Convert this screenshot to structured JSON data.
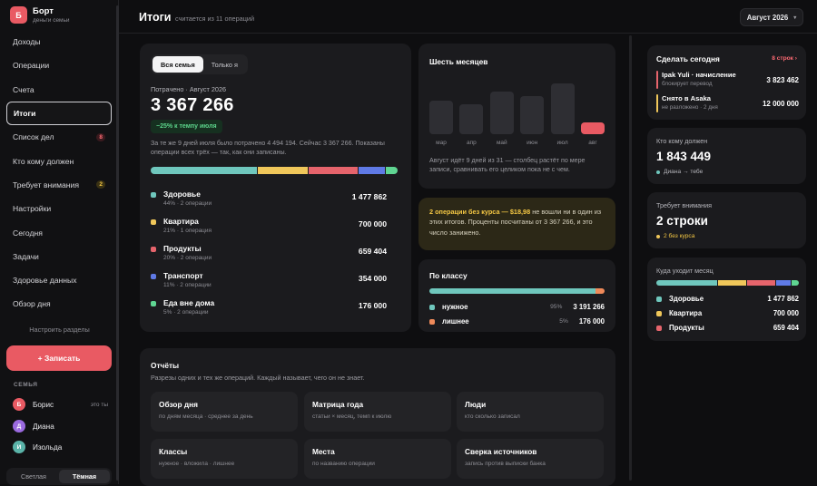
{
  "brand": {
    "logo_letter": "Б",
    "title": "Борт",
    "subtitle": "деньги семьи"
  },
  "nav": [
    {
      "label": "Доходы"
    },
    {
      "label": "Операции"
    },
    {
      "label": "Счета"
    },
    {
      "label": "Итоги",
      "active": true
    },
    {
      "label": "Список дел",
      "badge": "8",
      "badge_color": "red"
    },
    {
      "label": "Кто кому должен"
    },
    {
      "label": "Требует внимания",
      "badge": "2",
      "badge_color": "yellow"
    },
    {
      "label": "Настройки"
    },
    {
      "label": "Сегодня"
    },
    {
      "label": "Задачи"
    },
    {
      "label": "Здоровье данных"
    },
    {
      "label": "Обзор дня"
    }
  ],
  "configure_label": "Настроить разделы",
  "write_button": "+ Записать",
  "family_heading": "СЕМЬЯ",
  "members": [
    {
      "letter": "Б",
      "name": "Борис",
      "note": "это ты",
      "color": "#e95a63"
    },
    {
      "letter": "Д",
      "name": "Диана",
      "note": "",
      "color": "#9b6ae0"
    },
    {
      "letter": "И",
      "name": "Изольда",
      "note": "",
      "color": "#5ab3a8"
    }
  ],
  "theme": {
    "light": "Светлая",
    "dark": "Тёмная"
  },
  "header": {
    "title": "Итоги",
    "subtitle": "считается из 11 операций",
    "month": "Август 2026",
    "month_chevron": "▾"
  },
  "summary": {
    "tab_all": "Вся семья",
    "tab_me": "Только я",
    "label": "Потрачено · Август 2026",
    "total": "3 367 266",
    "pace": "−25% к темпу июля",
    "note": "За те же 9 дней июля было потрачено 4 494 194. Сейчас 3 367 266. Показаны операции всех трёх — так, как они записаны.",
    "bar": [
      {
        "share": 44,
        "color": "#6fc7bd"
      },
      {
        "share": 21,
        "color": "#f0c75a"
      },
      {
        "share": 20,
        "color": "#e6646c"
      },
      {
        "share": 11,
        "color": "#5f7ae6"
      },
      {
        "share": 5,
        "color": "#5fd592"
      }
    ],
    "categories": [
      {
        "name": "Здоровье",
        "sub": "44% · 2 операции",
        "value": "1 477 862",
        "color": "#6fc7bd"
      },
      {
        "name": "Квартира",
        "sub": "21% · 1 операция",
        "value": "700 000",
        "color": "#f0c75a"
      },
      {
        "name": "Продукты",
        "sub": "20% · 2 операции",
        "value": "659 404",
        "color": "#e6646c"
      },
      {
        "name": "Транспорт",
        "sub": "11% · 2 операции",
        "value": "354 000",
        "color": "#5f7ae6"
      },
      {
        "name": "Еда вне дома",
        "sub": "5% · 2 операции",
        "value": "176 000",
        "color": "#5fd592"
      }
    ]
  },
  "six_months": {
    "title": "Шесть месяцев",
    "months": [
      {
        "label": "мар",
        "level": 0.62
      },
      {
        "label": "апр",
        "level": 0.55
      },
      {
        "label": "май",
        "level": 0.78
      },
      {
        "label": "июн",
        "level": 0.7
      },
      {
        "label": "июл",
        "level": 0.94
      },
      {
        "label": "авг",
        "level": 0.22,
        "current": true
      }
    ],
    "note": "Август идёт 9 дней из 31 — столбец растёт по мере записи, сравнивать его целиком пока не с чем."
  },
  "fx_warning": {
    "highlight": "2 операции без курса — $18,98",
    "text": " не вошли ни в один из этих итогов. Проценты посчитаны от 3 367 266, и это число занижено."
  },
  "by_class": {
    "title": "По классу",
    "needed_share": 95,
    "rows": [
      {
        "name": "нужное",
        "pct": "95%",
        "value": "3 191 266",
        "color": "#6fc7bd"
      },
      {
        "name": "лишнее",
        "pct": "5%",
        "value": "176 000",
        "color": "#ef8a5a"
      }
    ]
  },
  "reports": {
    "title": "Отчёты",
    "subtitle": "Разрезы одних и тех же операций. Каждый называет, чего он не знает.",
    "items": [
      {
        "title": "Обзор дня",
        "sub": "по дням месяца · среднее за день"
      },
      {
        "title": "Матрица года",
        "sub": "статьи × месяц, темп к июлю"
      },
      {
        "title": "Люди",
        "sub": "кто сколько записал"
      },
      {
        "title": "Классы",
        "sub": "нужное · вложила · лишнее"
      },
      {
        "title": "Места",
        "sub": "по названию операции"
      },
      {
        "title": "Сверка источников",
        "sub": "запись против выписки банка"
      }
    ]
  },
  "today": {
    "title": "Сделать сегодня",
    "link": "8 строк ›",
    "items": [
      {
        "title": "Ipak Yuli · начисление",
        "sub": "блокирует перевод",
        "value": "3 823 462",
        "color": "#e6646c"
      },
      {
        "title": "Снято в Asaka",
        "sub": "не разложено · 2 дня",
        "value": "12 000 000",
        "color": "#f0c75a"
      }
    ]
  },
  "debts": {
    "label": "Кто кому должен",
    "value": "1 843 449",
    "who": "Диана → тебе",
    "dot_color": "#6fc7bd"
  },
  "attention": {
    "label": "Требует внимания",
    "value": "2 строки",
    "note": "2 без курса",
    "dot_color": "#f0c75a"
  },
  "where": {
    "title": "Куда уходит месяц",
    "bar": [
      {
        "share": 44,
        "color": "#6fc7bd"
      },
      {
        "share": 21,
        "color": "#f0c75a"
      },
      {
        "share": 20,
        "color": "#e6646c"
      },
      {
        "share": 11,
        "color": "#5f7ae6"
      },
      {
        "share": 5,
        "color": "#5fd592"
      }
    ],
    "rows": [
      {
        "name": "Здоровье",
        "value": "1 477 862",
        "color": "#6fc7bd"
      },
      {
        "name": "Квартира",
        "value": "700 000",
        "color": "#f0c75a"
      },
      {
        "name": "Продукты",
        "value": "659 404",
        "color": "#e6646c"
      }
    ]
  }
}
